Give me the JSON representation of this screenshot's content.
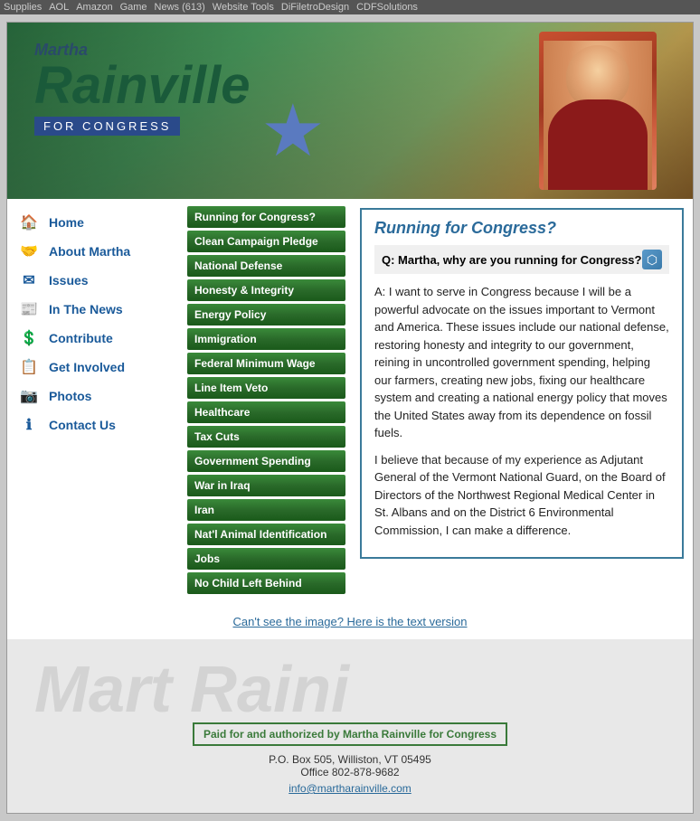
{
  "toolbar": {
    "items": [
      "Supplies",
      "AOL",
      "Amazon",
      "Game",
      "News (613)",
      "Website Tools",
      "DiFiletroDesign",
      "CDFSolutions"
    ]
  },
  "header": {
    "martha": "Martha",
    "rainville": "Rainville",
    "for_congress": "FOR CONGRESS"
  },
  "sidebar": {
    "items": [
      {
        "id": "home",
        "label": "Home",
        "icon": "🏠"
      },
      {
        "id": "about-martha",
        "label": "About Martha",
        "icon": "🤝"
      },
      {
        "id": "issues",
        "label": "Issues",
        "icon": "✉"
      },
      {
        "id": "in-the-news",
        "label": "In The News",
        "icon": "📰"
      },
      {
        "id": "contribute",
        "label": "Contribute",
        "icon": "💲"
      },
      {
        "id": "get-involved",
        "label": "Get Involved",
        "icon": "📋"
      },
      {
        "id": "photos",
        "label": "Photos",
        "icon": "📷"
      },
      {
        "id": "contact-us",
        "label": "Contact Us",
        "icon": "ℹ"
      }
    ]
  },
  "mid_nav": {
    "buttons": [
      "Running for Congress?",
      "Clean Campaign Pledge",
      "National Defense",
      "Honesty & Integrity",
      "Energy Policy",
      "Immigration",
      "Federal Minimum Wage",
      "Line Item Veto",
      "Healthcare",
      "Tax Cuts",
      "Government Spending",
      "War in Iraq",
      "Iran",
      "Nat'l Animal Identification",
      "Jobs",
      "No Child Left Behind"
    ]
  },
  "main": {
    "title": "Running for Congress?",
    "question": "Q: Martha, why are you running for Congress?",
    "answer_1": "A: I want to serve in Congress because I will be a powerful advocate on the issues important to Vermont and America. These issues include our national defense, restoring honesty and integrity to our government, reining in uncontrolled government spending, helping our farmers, creating new jobs, fixing our healthcare system and creating a national energy policy that moves the United States away from its dependence on fossil fuels.",
    "answer_2": "I believe that because of my experience as Adjutant General of the Vermont National Guard, on the Board of Directors of the Northwest Regional Medical Center in St. Albans and on the District 6 Environmental Commission, I can make a difference."
  },
  "footer": {
    "link_text": "Can't see the image? Here is the text version",
    "watermark": "Mart Raini",
    "paid_text": "Paid for and authorized by Martha Rainville for Congress",
    "address": "P.O. Box 505, Williston, VT 05495",
    "phone": "Office 802-878-9682",
    "email": "info@martharainville.com"
  }
}
